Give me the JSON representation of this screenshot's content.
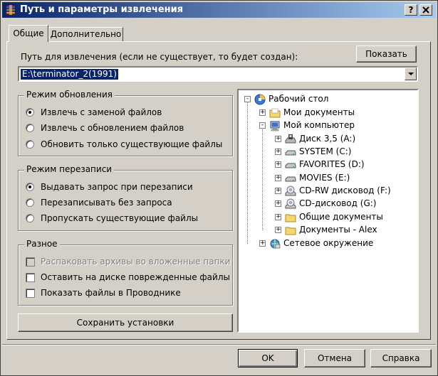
{
  "window": {
    "title": "Путь и параметры извлечения",
    "help_button": "?",
    "close_button": "X"
  },
  "tabs": [
    {
      "label": "Общие",
      "active": true
    },
    {
      "label": "Дополнительно",
      "active": false
    }
  ],
  "path": {
    "label": "Путь для извлечения (если не существует, то будет создан):",
    "show_button": "Показать",
    "value": "E:\\terminator_2(1991)"
  },
  "update_mode": {
    "title": "Режим обновления",
    "options": [
      {
        "label": "Извлечь с заменой файлов",
        "selected": true
      },
      {
        "label": "Извлечь с обновлением файлов",
        "selected": false
      },
      {
        "label": "Обновить только существующие файлы",
        "selected": false
      }
    ]
  },
  "overwrite_mode": {
    "title": "Режим перезаписи",
    "options": [
      {
        "label": "Выдавать запрос при перезаписи",
        "selected": true
      },
      {
        "label": "Перезаписывать без запроса",
        "selected": false
      },
      {
        "label": "Пропускать существующие файлы",
        "selected": false
      }
    ]
  },
  "misc": {
    "title": "Разное",
    "options": [
      {
        "label": "Распаковать архивы во вложенные папки",
        "checked": false,
        "disabled": true
      },
      {
        "label": "Оставить на диске поврежденные файлы",
        "checked": false,
        "disabled": false
      },
      {
        "label": "Показать файлы в Проводнике",
        "checked": false,
        "disabled": false
      }
    ]
  },
  "save_settings_button": "Сохранить установки",
  "tree": {
    "nodes": [
      {
        "label": "Рабочий стол",
        "icon": "desktop-icon",
        "level": 0,
        "expander": "-"
      },
      {
        "label": "Мои документы",
        "icon": "folder-icon",
        "level": 1,
        "expander": "+"
      },
      {
        "label": "Мой компьютер",
        "icon": "computer-icon",
        "level": 1,
        "expander": "-"
      },
      {
        "label": "Диск 3,5 (A:)",
        "icon": "floppy-icon",
        "level": 2,
        "expander": "+"
      },
      {
        "label": "SYSTEM (C:)",
        "icon": "hard-drive-icon",
        "level": 2,
        "expander": "+"
      },
      {
        "label": "FAVORITES (D:)",
        "icon": "hard-drive-icon",
        "level": 2,
        "expander": "+"
      },
      {
        "label": "MOVIES (E:)",
        "icon": "hard-drive-icon",
        "level": 2,
        "expander": "+"
      },
      {
        "label": "CD-RW дисковод (F:)",
        "icon": "cd-drive-icon",
        "level": 2,
        "expander": "+"
      },
      {
        "label": "CD-дисковод (G:)",
        "icon": "cd-drive-icon",
        "level": 2,
        "expander": "+"
      },
      {
        "label": "Общие документы",
        "icon": "folder-icon",
        "level": 2,
        "expander": "+"
      },
      {
        "label": "Документы - Alex",
        "icon": "folder-icon",
        "level": 2,
        "expander": "+"
      },
      {
        "label": "Сетевое окружение",
        "icon": "network-icon",
        "level": 1,
        "expander": "+"
      }
    ]
  },
  "footer": {
    "ok": "OK",
    "cancel": "Отмена",
    "help": "Справка"
  },
  "colors": {
    "title_bar_start": "#0a246a",
    "title_bar_end": "#a6caf0",
    "face": "#d4d0c8",
    "selection": "#0a246a"
  }
}
